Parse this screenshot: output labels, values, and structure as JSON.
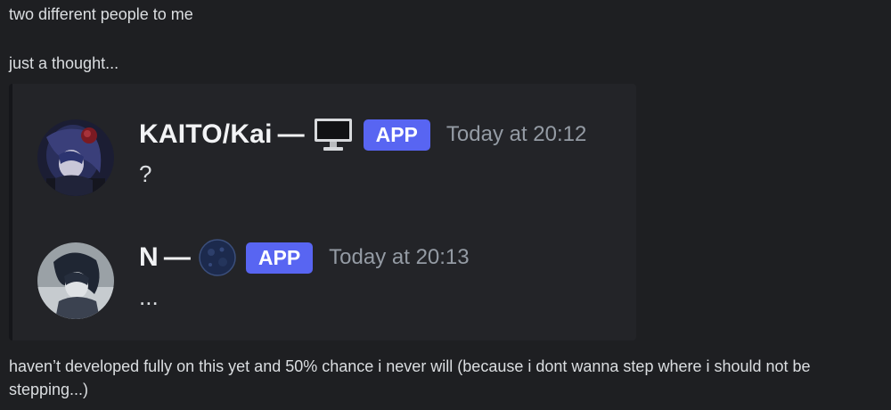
{
  "chat": {
    "line1": "two different people to me",
    "line2": "just a thought...",
    "line3": "haven’t developed fully on this yet and 50% chance i never will (because i dont wanna step where i should not be stepping...)"
  },
  "embed": {
    "messages": [
      {
        "username": "KAITO/Kai",
        "separator": "—",
        "status_icon": "monitor-icon",
        "badge": "APP",
        "timestamp": "Today at 20:12",
        "content": "?"
      },
      {
        "username": "N",
        "separator": "—",
        "status_icon": "moon-icon",
        "badge": "APP",
        "timestamp": "Today at 20:13",
        "content": "..."
      }
    ]
  },
  "colors": {
    "background": "#1e1f22",
    "embed_background": "#232428",
    "app_badge": "#5865f2",
    "timestamp": "#949ba4",
    "text": "#dbdee1"
  }
}
